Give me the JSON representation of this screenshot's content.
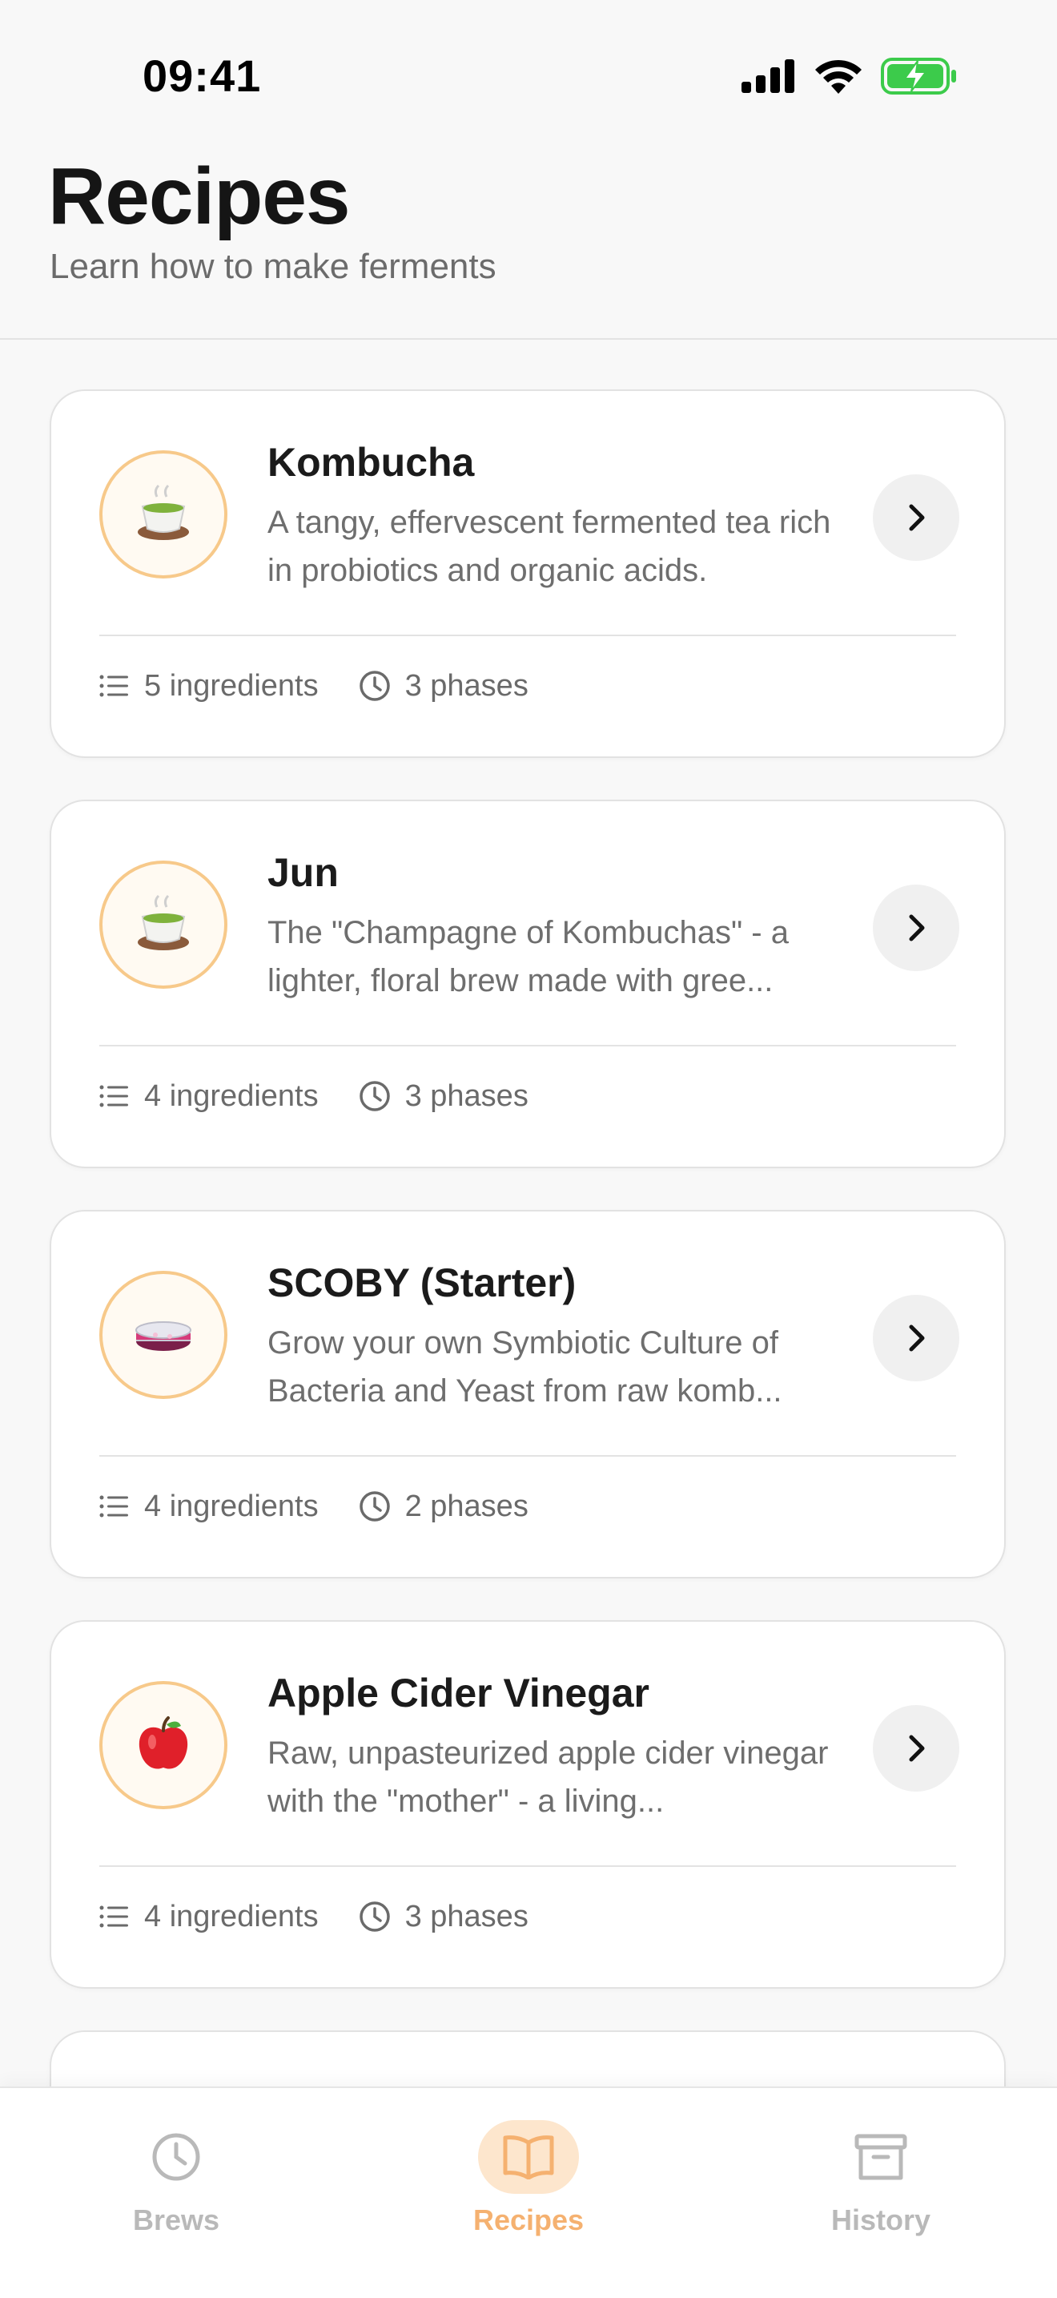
{
  "status_bar": {
    "time": "09:41",
    "icons": [
      "signal-icon",
      "wifi-icon",
      "battery-charging-icon"
    ],
    "battery_color": "#3ccb4b"
  },
  "header": {
    "title": "Recipes",
    "subtitle": "Learn how to make ferments"
  },
  "accent_color": "#f5b170",
  "recipes": [
    {
      "title": "Kombucha",
      "emoji": "🍵",
      "description": "A tangy, effervescent fermented tea rich in probiotics and organic acids.",
      "ingredients": "5 ingredients",
      "phases": "3 phases"
    },
    {
      "title": "Jun",
      "emoji": "🍵",
      "description": "The \"Champagne of Kombuchas\" - a lighter, floral brew made with gree...",
      "ingredients": "4 ingredients",
      "phases": "3 phases"
    },
    {
      "title": "SCOBY (Starter)",
      "emoji": "🧫",
      "description": "Grow your own Symbiotic Culture of Bacteria and Yeast from raw komb...",
      "ingredients": "4 ingredients",
      "phases": "2 phases"
    },
    {
      "title": "Apple Cider Vinegar",
      "emoji": "🍎",
      "description": "Raw, unpasteurized apple cider vinegar with the \"mother\" - a living...",
      "ingredients": "4 ingredients",
      "phases": "3 phases"
    }
  ],
  "tabs": [
    {
      "label": "Brews",
      "icon": "clock-icon",
      "active": false
    },
    {
      "label": "Recipes",
      "icon": "book-icon",
      "active": true
    },
    {
      "label": "History",
      "icon": "archive-icon",
      "active": false
    }
  ]
}
